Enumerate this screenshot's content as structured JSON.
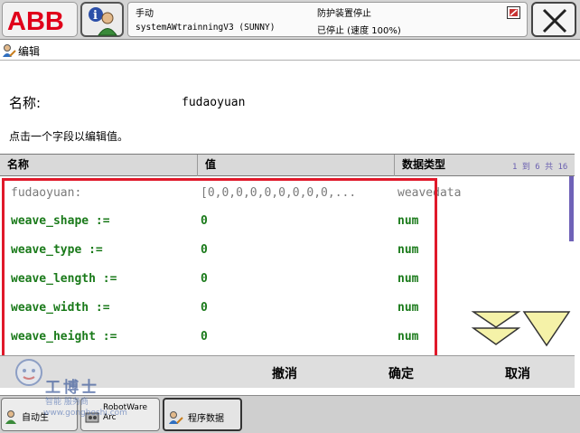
{
  "header": {
    "logo": "ABB",
    "mode": "手动",
    "system": "systemAWtrainningV3 (SUNNY)",
    "guard": "防护装置停止",
    "state": "已停止 (速度 100%)"
  },
  "editor": {
    "title": "编辑",
    "name_label": "名称:",
    "name_value": "fudaoyuan",
    "hint": "点击一个字段以编辑值。"
  },
  "table": {
    "columns": [
      "名称",
      "值",
      "数据类型"
    ],
    "pager": "1 到 6 共 16",
    "rows": [
      {
        "name": "fudaoyuan:",
        "value": "[0,0,0,0,0,0,0,0,0,...",
        "type": "weavedata"
      },
      {
        "name": "weave_shape :=",
        "value": "0",
        "type": "num"
      },
      {
        "name": "weave_type :=",
        "value": "0",
        "type": "num"
      },
      {
        "name": "weave_length :=",
        "value": "0",
        "type": "num"
      },
      {
        "name": "weave_width :=",
        "value": "0",
        "type": "num"
      },
      {
        "name": "weave_height :=",
        "value": "0",
        "type": "num"
      }
    ]
  },
  "actions": {
    "undo": "撤消",
    "ok": "确定",
    "cancel": "取消"
  },
  "watermark": {
    "brand": "工博士",
    "sub": "智能  服务商",
    "url": "www.gongboshi.com"
  },
  "taskbar": {
    "items": [
      "自动生",
      "RobotWare Arc",
      "程序数据"
    ]
  },
  "colors": {
    "field_text": "#1a7a1a",
    "highlight": "#e0192a",
    "abb_red": "#e0001a",
    "scroll": "#6f62b8",
    "arrow_fill": "#f5f2a8"
  }
}
